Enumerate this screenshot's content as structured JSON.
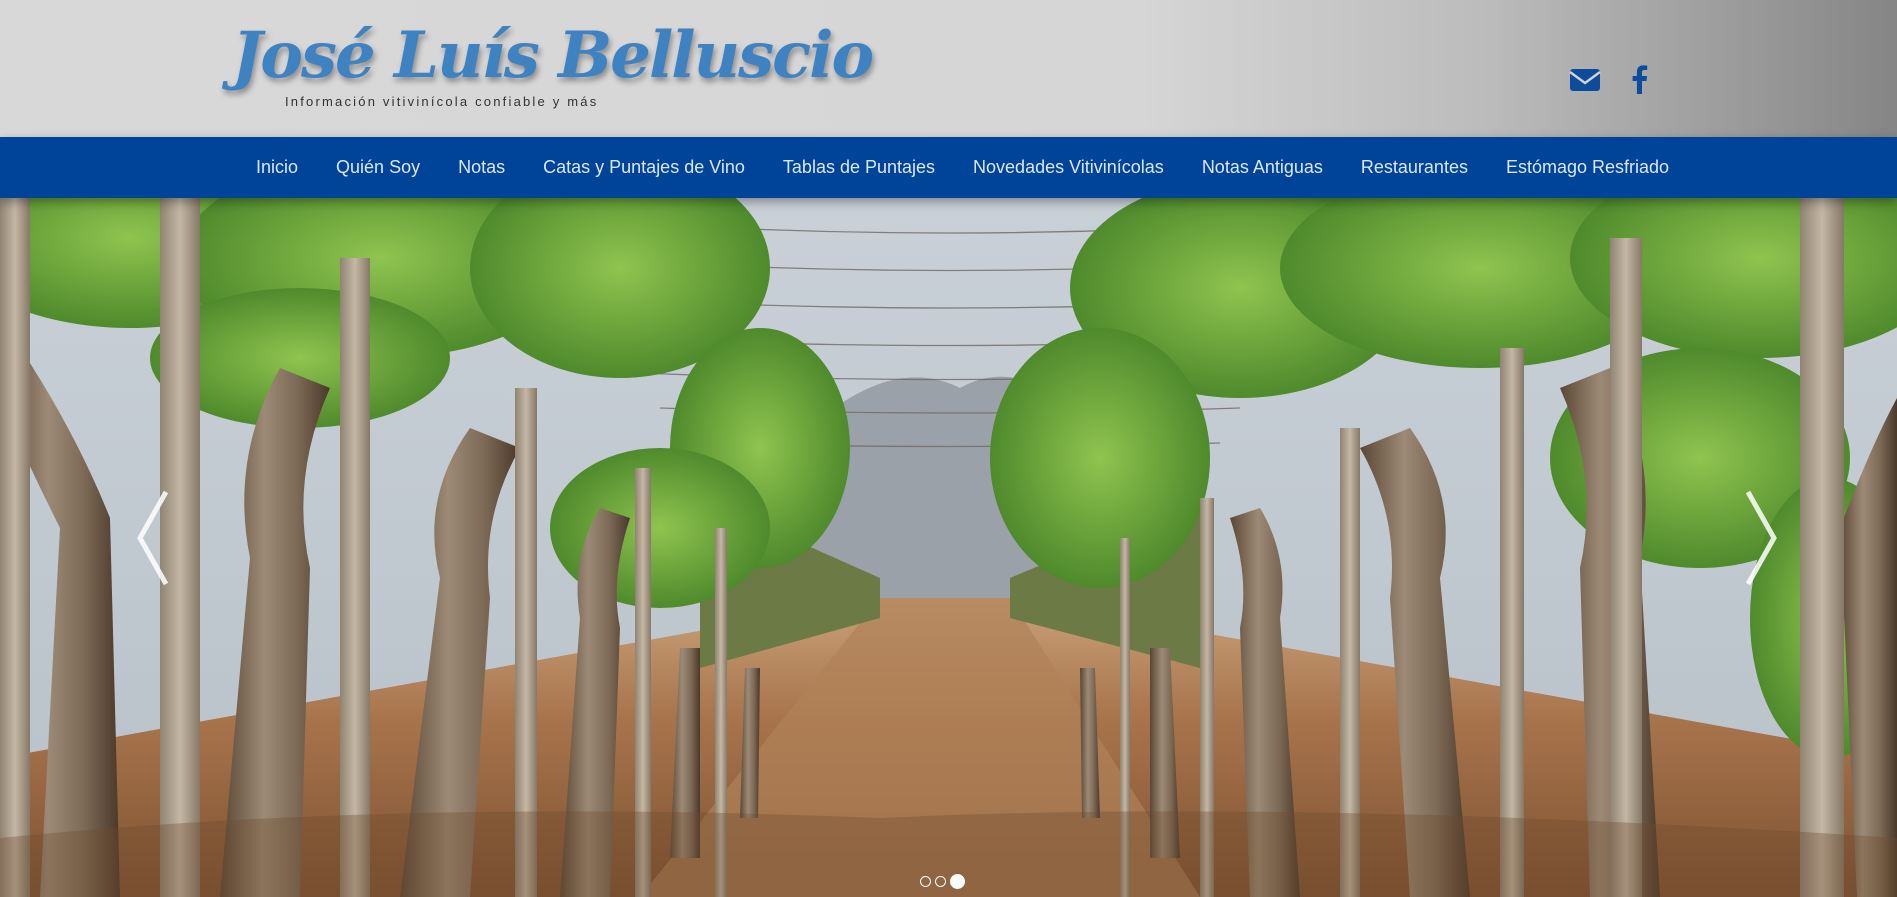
{
  "colors": {
    "brand_blue": "#004499",
    "logo_blue": "#3e82c2",
    "nav_text": "#dde6f2",
    "icon_blue": "#0d4c9c"
  },
  "header": {
    "logo_title": "José Luís Belluscio",
    "logo_tagline": "Información vitivinícola confiable y más",
    "social": [
      {
        "icon": "envelope-icon"
      },
      {
        "icon": "facebook-icon"
      }
    ]
  },
  "nav": {
    "items": [
      {
        "label": "Inicio"
      },
      {
        "label": "Quién Soy"
      },
      {
        "label": "Notas"
      },
      {
        "label": "Catas y Puntajes de Vino"
      },
      {
        "label": "Tablas de Puntajes"
      },
      {
        "label": "Novedades Vitivinícolas"
      },
      {
        "label": "Notas Antiguas"
      },
      {
        "label": "Restaurantes"
      },
      {
        "label": "Estómago Resfriado"
      }
    ]
  },
  "carousel": {
    "slide_count": 3,
    "active_slide": 3,
    "prev_icon": "chevron-left-icon",
    "next_icon": "chevron-right-icon"
  }
}
